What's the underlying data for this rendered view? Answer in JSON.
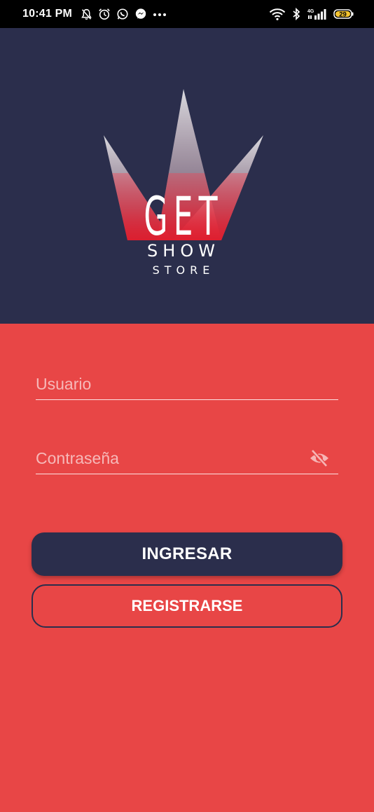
{
  "status_bar": {
    "time": "10:41 PM",
    "battery": "29",
    "network": "4G",
    "icons": [
      "mute-bell-icon",
      "alarm-icon",
      "whatsapp-icon",
      "messenger-icon",
      "more-dots-icon",
      "wifi-icon",
      "bluetooth-icon",
      "signal-icon",
      "battery-icon"
    ]
  },
  "logo": {
    "line1": "GET",
    "line2": "SHOW",
    "line3": "STORE"
  },
  "form": {
    "username_placeholder": "Usuario",
    "password_placeholder": "Contraseña",
    "password_icon": "eye-off-icon",
    "login_label": "INGRESAR",
    "register_label": "REGISTRARSE"
  },
  "colors": {
    "header_bg": "#2b2e4c",
    "form_bg": "#e84646",
    "accent": "#2b2e4c"
  }
}
